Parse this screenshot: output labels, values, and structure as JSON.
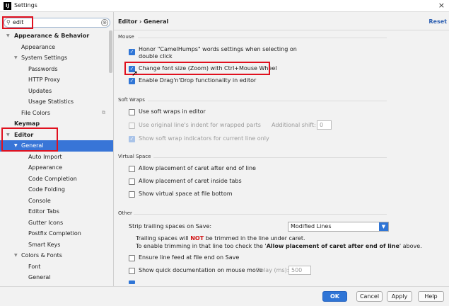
{
  "window": {
    "app_icon": "IJ",
    "title": "Settings",
    "close": "×"
  },
  "search": {
    "icon": "⚲",
    "value": "edit",
    "clear": "⊗"
  },
  "tree": [
    "Appearance & Behavior",
    "Appearance",
    "System Settings",
    "Passwords",
    "HTTP Proxy",
    "Updates",
    "Usage Statistics",
    "File Colors",
    "Keymap",
    "Editor",
    "General",
    "Auto Import",
    "Appearance",
    "Code Completion",
    "Code Folding",
    "Console",
    "Editor Tabs",
    "Gutter Icons",
    "Postfix Completion",
    "Smart Keys",
    "Colors & Fonts",
    "Font",
    "General"
  ],
  "breadcrumb": "Editor › General",
  "reset": "Reset",
  "sections": {
    "mouse": "Mouse",
    "soft_wraps": "Soft Wraps",
    "virtual_space": "Virtual Space",
    "other": "Other"
  },
  "mouse": {
    "camel_line1": "Honor \"CamelHumps\" words settings when selecting on",
    "camel_line2": "double click",
    "zoom": "Change font size (Zoom) with Ctrl+Mouse Wheel",
    "dnd": "Enable Drag'n'Drop functionality in editor"
  },
  "soft": {
    "use": "Use soft wraps in editor",
    "indent": "Use original line's indent for wrapped parts",
    "shift_label": "Additional shift:",
    "shift_value": "0",
    "indicators": "Show soft wrap indicators for current line only"
  },
  "virtual": {
    "after_end": "Allow placement of caret after end of line",
    "inside_tabs": "Allow placement of caret inside tabs",
    "bottom": "Show virtual space at file bottom"
  },
  "other": {
    "strip_label": "Strip trailing spaces on Save:",
    "strip_value": "Modified Lines",
    "note1_a": "Trailing spaces will ",
    "note1_b": "NOT",
    "note1_c": " be trimmed in the line under caret.",
    "note2_a": "To enable trimming in that line too check the '",
    "note2_b": "Allow placement of caret after end of line",
    "note2_c": "' above.",
    "linefeed": "Ensure line feed at file end on Save",
    "quickdoc": "Show quick documentation on mouse move",
    "delay_label": "Delay (ms):",
    "delay_value": "500"
  },
  "buttons": {
    "ok": "OK",
    "cancel": "Cancel",
    "apply": "Apply",
    "help": "Help"
  },
  "colors": {
    "accent": "#2f75d6",
    "selection": "#3875d7",
    "highlight": "#e0101e"
  }
}
